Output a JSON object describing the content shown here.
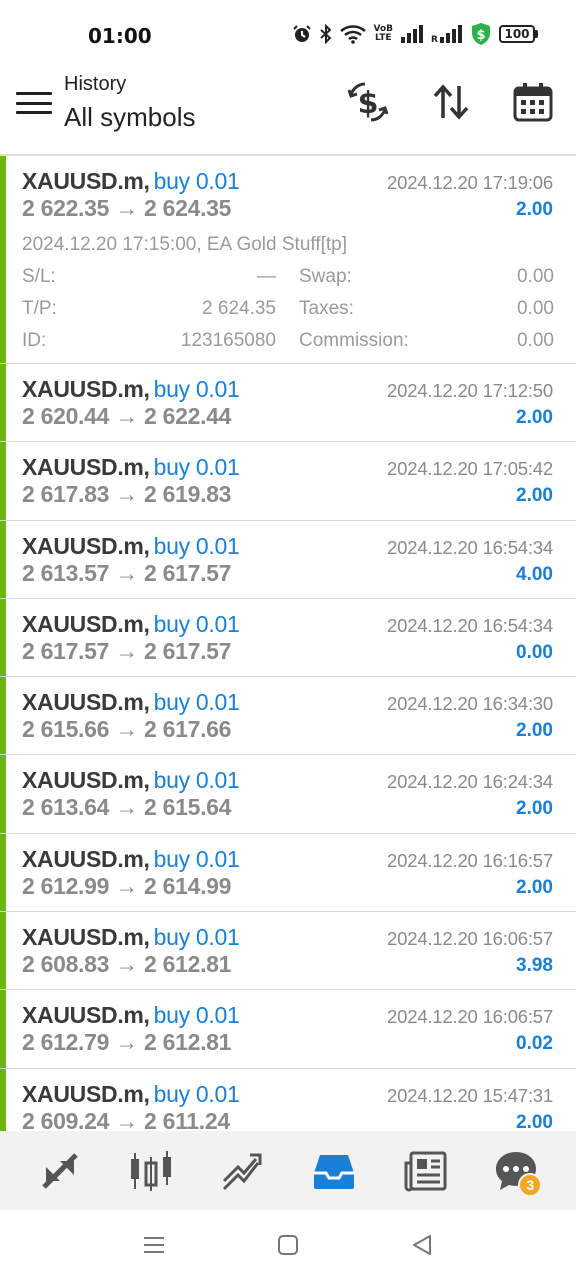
{
  "status_bar": {
    "time": "01:00",
    "battery": "100",
    "network_label": "VoB LTE"
  },
  "header": {
    "subtitle": "History",
    "title": "All symbols"
  },
  "trades": [
    {
      "symbol": "XAUUSD.m,",
      "side": "buy 0.01",
      "time": "2024.12.20 17:19:06",
      "prices": "2 622.35 → 2 624.35",
      "profit": "2.00",
      "expanded": true,
      "details": {
        "open_line": "2024.12.20 17:15:00, EA Gold Stuff[tp]",
        "sl_label": "S/L:",
        "sl_value": "—",
        "swap_label": "Swap:",
        "swap_value": "0.00",
        "tp_label": "T/P:",
        "tp_value": "2 624.35",
        "taxes_label": "Taxes:",
        "taxes_value": "0.00",
        "id_label": "ID:",
        "id_value": "123165080",
        "commission_label": "Commission:",
        "commission_value": "0.00"
      }
    },
    {
      "symbol": "XAUUSD.m,",
      "side": "buy 0.01",
      "time": "2024.12.20 17:12:50",
      "prices": "2 620.44 → 2 622.44",
      "profit": "2.00"
    },
    {
      "symbol": "XAUUSD.m,",
      "side": "buy 0.01",
      "time": "2024.12.20 17:05:42",
      "prices": "2 617.83 → 2 619.83",
      "profit": "2.00"
    },
    {
      "symbol": "XAUUSD.m,",
      "side": "buy 0.01",
      "time": "2024.12.20 16:54:34",
      "prices": "2 613.57 → 2 617.57",
      "profit": "4.00"
    },
    {
      "symbol": "XAUUSD.m,",
      "side": "buy 0.01",
      "time": "2024.12.20 16:54:34",
      "prices": "2 617.57 → 2 617.57",
      "profit": "0.00"
    },
    {
      "symbol": "XAUUSD.m,",
      "side": "buy 0.01",
      "time": "2024.12.20 16:34:30",
      "prices": "2 615.66 → 2 617.66",
      "profit": "2.00"
    },
    {
      "symbol": "XAUUSD.m,",
      "side": "buy 0.01",
      "time": "2024.12.20 16:24:34",
      "prices": "2 613.64 → 2 615.64",
      "profit": "2.00"
    },
    {
      "symbol": "XAUUSD.m,",
      "side": "buy 0.01",
      "time": "2024.12.20 16:16:57",
      "prices": "2 612.99 → 2 614.99",
      "profit": "2.00"
    },
    {
      "symbol": "XAUUSD.m,",
      "side": "buy 0.01",
      "time": "2024.12.20 16:06:57",
      "prices": "2 608.83 → 2 612.81",
      "profit": "3.98"
    },
    {
      "symbol": "XAUUSD.m,",
      "side": "buy 0.01",
      "time": "2024.12.20 16:06:57",
      "prices": "2 612.79 → 2 612.81",
      "profit": "0.02"
    },
    {
      "symbol": "XAUUSD.m,",
      "side": "buy 0.01",
      "time": "2024.12.20 15:47:31",
      "prices": "2 609.24 → 2 611.24",
      "profit": "2.00"
    }
  ],
  "bottom_nav": {
    "items": [
      "quotes-icon",
      "chart-icon",
      "trade-icon",
      "history-icon",
      "news-icon",
      "chat-icon"
    ],
    "active": "history-icon",
    "chat_badge": "3"
  },
  "colors": {
    "accent_blue": "#1a7fd6",
    "buy_bar_green": "#6ab70f",
    "badge_orange": "#f5a623",
    "vpn_green": "#2bb24c"
  }
}
